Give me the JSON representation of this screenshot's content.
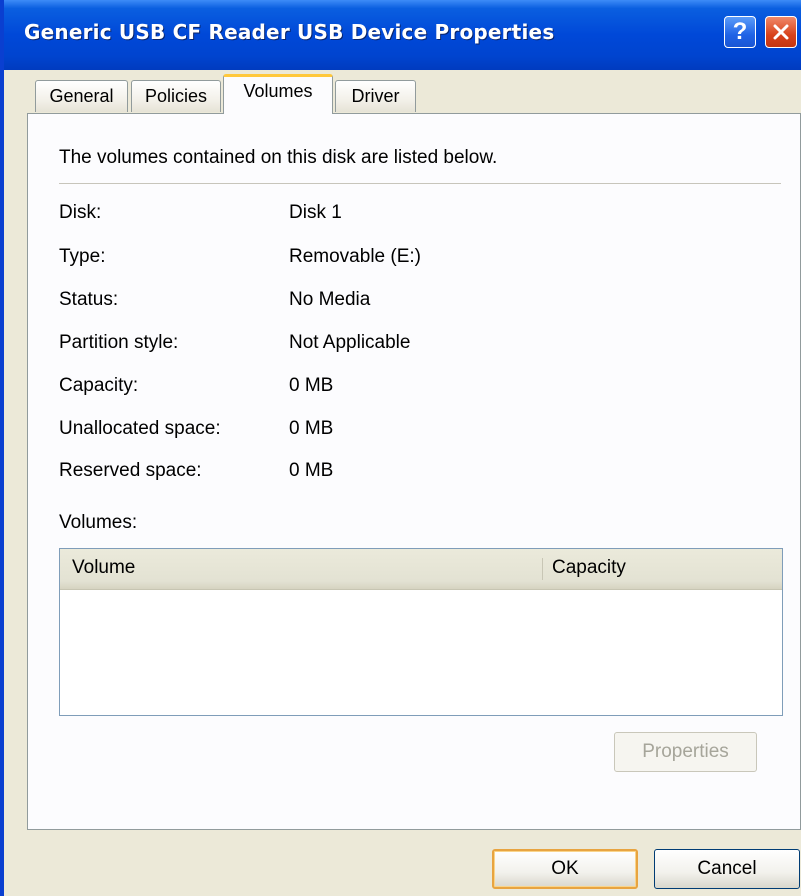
{
  "window": {
    "title": "Generic USB CF Reader USB Device Properties",
    "help_glyph": "?",
    "close_icon": "close-icon"
  },
  "tabs": [
    {
      "label": "General"
    },
    {
      "label": "Policies"
    },
    {
      "label": "Volumes",
      "active": true
    },
    {
      "label": "Driver"
    }
  ],
  "panel": {
    "intro": "The volumes contained on this disk are listed below.",
    "details": [
      {
        "label": "Disk:",
        "value": "Disk 1"
      },
      {
        "label": "Type:",
        "value": "Removable (E:)"
      },
      {
        "label": "Status:",
        "value": "No Media"
      },
      {
        "label": "Partition style:",
        "value": "Not Applicable"
      },
      {
        "label": "Capacity:",
        "value": "0 MB"
      },
      {
        "label": "Unallocated space:",
        "value": "0 MB"
      },
      {
        "label": "Reserved space:",
        "value": "0 MB"
      }
    ],
    "volumes_label": "Volumes:",
    "columns": [
      "Volume",
      "Capacity"
    ],
    "properties_button": "Properties"
  },
  "footer": {
    "ok": "OK",
    "cancel": "Cancel"
  },
  "colors": {
    "titlebar": "#0048d8",
    "active_tab_accent": "#ffc83c",
    "default_button_border": "#e8a440"
  }
}
